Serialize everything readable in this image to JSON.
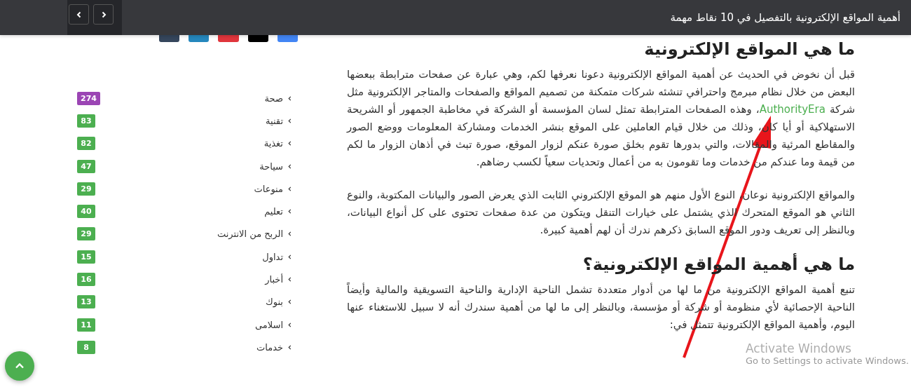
{
  "header": {
    "title": "أهمية المواقع الإلكترونية بالتفصيل في 10 نقاط مهمة",
    "nav_buttons": [
      {
        "kind": "previous"
      },
      {
        "kind": "next"
      }
    ]
  },
  "share_buttons": [
    {
      "color": "#35465c"
    },
    {
      "color": "#2587bd"
    },
    {
      "color": "#e0353c"
    },
    {
      "color": "#000000"
    },
    {
      "color": "#4285f4"
    }
  ],
  "article": [
    {
      "kind": "heading",
      "text": "ما هي المواقع الإلكترونية"
    },
    {
      "kind": "paragraph",
      "text_before": "قبل أن نخوض في الحديث عن أهمية المواقع الإلكترونية دعونا نعرفها لكم، وهي عبارة عن صفحات مترابطة ببعضها البعض من خلال نظام مبرمج واحترافي تنشئه شركات متمكنة من تصميم المواقع والصفحات والمتاجر الإلكترونية مثل شركة ",
      "link": "AuthorityEra",
      "text_after": "، وهذه الصفحات المترابطة تمثل لسان المؤسسة أو الشركة في مخاطبة الجمهور أو الشريحة الاستهلاكية أو أيا كان، وذلك من خلال قيام العاملين على الموقع بنشر الخدمات ومشاركة المعلومات ووضع الصور والمقاطع المرئية والمقالات، والتي بدورها تقوم بخلق صورة عنكم لزوار الموقع، صورة تبث في أذهان الزوار ما لكم من قيمة وما عندكم من خدمات وما تقومون به من أعمال وتحديات سعياً لكسب رضاهم."
    },
    {
      "kind": "paragraph",
      "text_before": "والمواقع الإلكترونية نوعان، النوع الأول منهم هو الموقع الإلكتروني الثابت الذي يعرض الصور والبيانات المكتوبة، والنوع الثاني هو الموقع المتحرك الذي يشتمل على خيارات التنقل ويتكون من عدة صفحات تحتوى على كل أنواع البيانات، وبالنظر إلى تعريف ودور الموقع السابق ذكرهم ندرك أن لهم أهمية كبيرة."
    },
    {
      "kind": "heading",
      "text": "ما هي أهمية المواقع الإلكترونية؟"
    },
    {
      "kind": "paragraph",
      "text_before": "تنبع أهمية المواقع الإلكترونية من ما لها من أدوار متعددة تشمل الناحية الإدارية والناحية التسويقية والمالية وأيضاً الناحية الإحصائية لأي منظومة أو شركة أو مؤسسة، وبالنظر إلى ما لها من أهمية سندرك أنه لا سبيل للاستغناء عنها اليوم، وأهمية المواقع الإلكترونية تتمثل في:"
    }
  ],
  "categories": [
    {
      "label": "صحة",
      "count": "274",
      "color": "#9b45b4"
    },
    {
      "label": "تقنية",
      "count": "83",
      "color": "#4caf50"
    },
    {
      "label": "تغذية",
      "count": "82",
      "color": "#4caf50"
    },
    {
      "label": "سياحة",
      "count": "47",
      "color": "#4caf50"
    },
    {
      "label": "منوعات",
      "count": "29",
      "color": "#4caf50"
    },
    {
      "label": "تعليم",
      "count": "40",
      "color": "#4caf50"
    },
    {
      "label": "الربح من الانترنت",
      "count": "29",
      "color": "#4caf50"
    },
    {
      "label": "تداول",
      "count": "15",
      "color": "#4caf50"
    },
    {
      "label": "أخبار",
      "count": "16",
      "color": "#4caf50"
    },
    {
      "label": "بنوك",
      "count": "13",
      "color": "#4caf50"
    },
    {
      "label": "اسلامى",
      "count": "11",
      "color": "#4caf50"
    },
    {
      "label": "خدمات",
      "count": "8",
      "color": "#4caf50"
    }
  ],
  "activation_notice": {
    "title": "Activate Windows",
    "subtitle": "Go to Settings to activate Windows."
  }
}
